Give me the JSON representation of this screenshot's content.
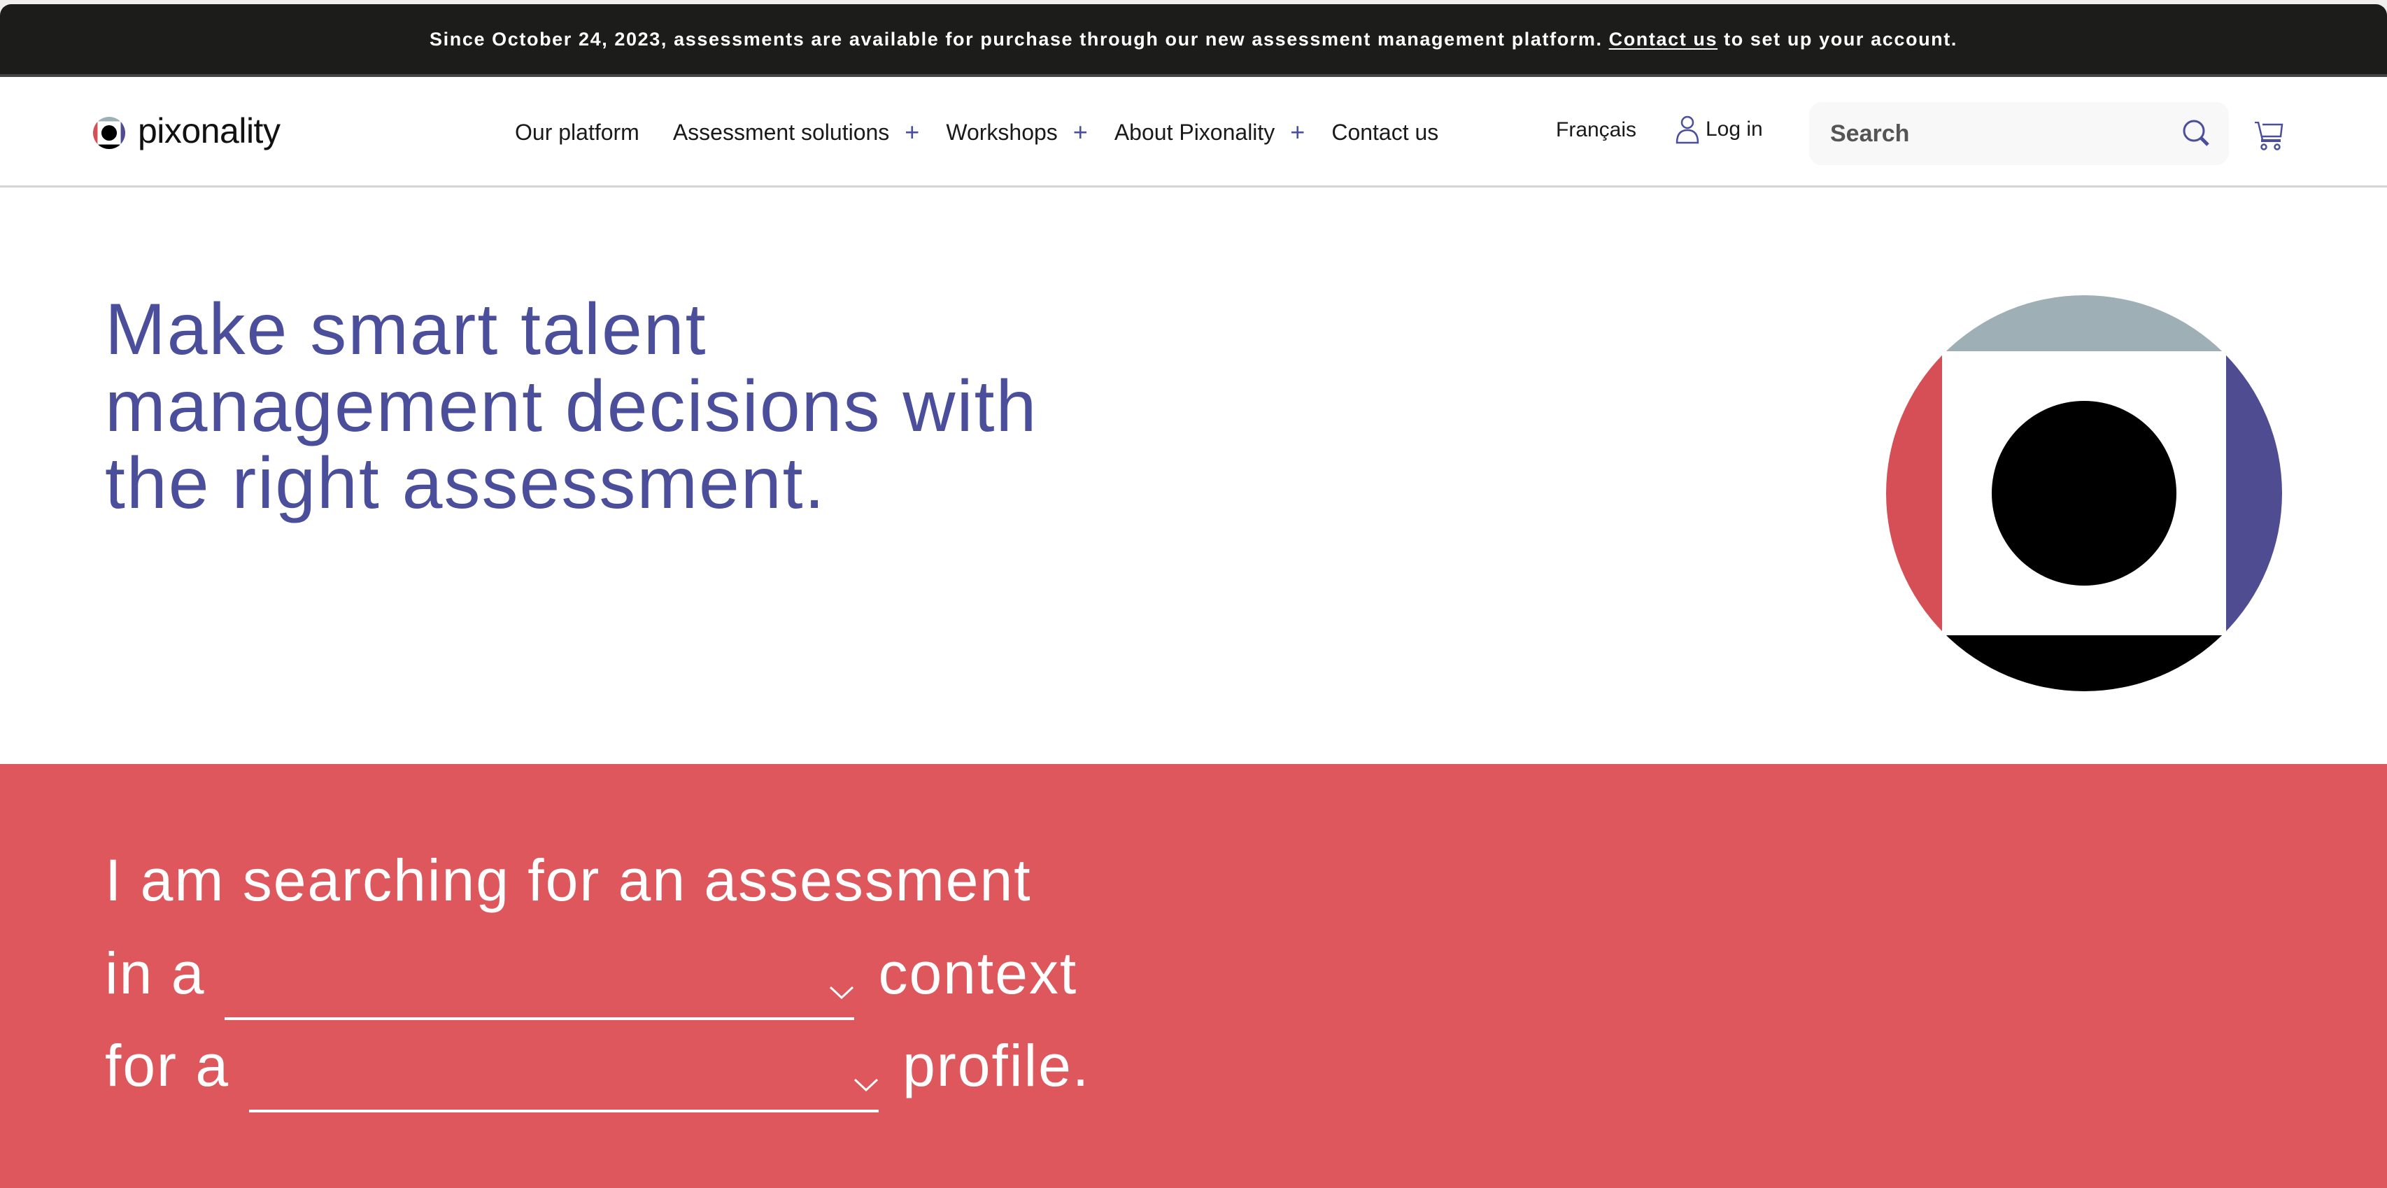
{
  "announcement": {
    "text_before": "Since October 24, 2023, assessments are available for purchase through our new assessment management platform.",
    "link_label": "Contact us",
    "text_after": "to set up your account."
  },
  "header": {
    "logo_text": "pixonality",
    "nav": [
      {
        "label": "Our platform",
        "expandable": false
      },
      {
        "label": "Assessment solutions",
        "expandable": true
      },
      {
        "label": "Workshops",
        "expandable": true
      },
      {
        "label": "About Pixonality",
        "expandable": true
      },
      {
        "label": "Contact us",
        "expandable": false
      }
    ],
    "expand_glyph": "+",
    "language_label": "Français",
    "login_label": "Log in",
    "search_placeholder": "Search",
    "search_value": ""
  },
  "hero": {
    "title": "Make smart talent management decisions with the right assessment.",
    "title_lines": [
      "Make smart talent",
      "management decisions with",
      "the right assessment."
    ]
  },
  "finder": {
    "line1": "I am searching for an assessment",
    "line2_prefix": "in a",
    "line2_suffix": "context",
    "line3_prefix": "for a",
    "line3_suffix": "profile.",
    "context_select_value": "",
    "profile_select_value": ""
  },
  "colors": {
    "brand_blue": "#4b4f9b",
    "brand_red": "#de575c",
    "logo_gray": "#9eafb5",
    "logo_red": "#d64f56",
    "logo_purple": "#4f4c91",
    "announcement_bg": "#1c1c1b"
  }
}
